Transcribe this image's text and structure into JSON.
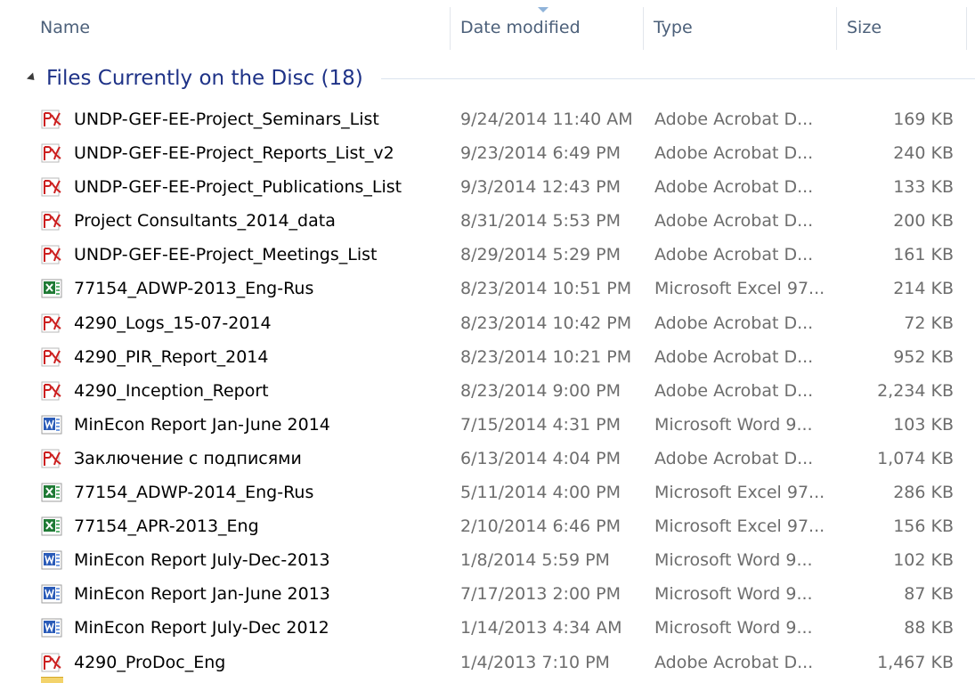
{
  "columns": {
    "name": "Name",
    "date_modified": "Date modified",
    "type": "Type",
    "size": "Size"
  },
  "group": {
    "title": "Files Currently on the Disc (18)"
  },
  "colors": {
    "group_title": "#1e3287",
    "header_text": "#4c607a",
    "secondary_text": "#6d6d6d",
    "pdf_icon": "#cc1f1f",
    "excel_icon": "#1f7a35",
    "word_icon": "#2a5bb8"
  },
  "files": [
    {
      "icon": "pdf-icon",
      "name": "UNDP-GEF-EE-Project_Seminars_List",
      "date": "9/24/2014 11:40 AM",
      "type": "Adobe Acrobat D...",
      "size": "169 KB"
    },
    {
      "icon": "pdf-icon",
      "name": "UNDP-GEF-EE-Project_Reports_List_v2",
      "date": "9/23/2014 6:49 PM",
      "type": "Adobe Acrobat D...",
      "size": "240 KB"
    },
    {
      "icon": "pdf-icon",
      "name": "UNDP-GEF-EE-Project_Publications_List",
      "date": "9/3/2014 12:43 PM",
      "type": "Adobe Acrobat D...",
      "size": "133 KB"
    },
    {
      "icon": "pdf-icon",
      "name": "Project Consultants_2014_data",
      "date": "8/31/2014 5:53 PM",
      "type": "Adobe Acrobat D...",
      "size": "200 KB"
    },
    {
      "icon": "pdf-icon",
      "name": "UNDP-GEF-EE-Project_Meetings_List",
      "date": "8/29/2014 5:29 PM",
      "type": "Adobe Acrobat D...",
      "size": "161 KB"
    },
    {
      "icon": "excel-icon",
      "name": "77154_ADWP-2013_Eng-Rus",
      "date": "8/23/2014 10:51 PM",
      "type": "Microsoft Excel 97...",
      "size": "214 KB"
    },
    {
      "icon": "pdf-icon",
      "name": "4290_Logs_15-07-2014",
      "date": "8/23/2014 10:42 PM",
      "type": "Adobe Acrobat D...",
      "size": "72 KB"
    },
    {
      "icon": "pdf-icon",
      "name": "4290_PIR_Report_2014",
      "date": "8/23/2014 10:21 PM",
      "type": "Adobe Acrobat D...",
      "size": "952 KB"
    },
    {
      "icon": "pdf-icon",
      "name": "4290_Inception_Report",
      "date": "8/23/2014 9:00 PM",
      "type": "Adobe Acrobat D...",
      "size": "2,234 KB"
    },
    {
      "icon": "word-icon",
      "name": "MinEcon Report Jan-June 2014",
      "date": "7/15/2014 4:31 PM",
      "type": "Microsoft Word 9...",
      "size": "103 KB"
    },
    {
      "icon": "pdf-icon",
      "name": "Заключение с подписями",
      "date": "6/13/2014 4:04 PM",
      "type": "Adobe Acrobat D...",
      "size": "1,074 KB"
    },
    {
      "icon": "excel-icon",
      "name": "77154_ADWP-2014_Eng-Rus",
      "date": "5/11/2014 4:00 PM",
      "type": "Microsoft Excel 97...",
      "size": "286 KB"
    },
    {
      "icon": "excel-icon",
      "name": "77154_APR-2013_Eng",
      "date": "2/10/2014 6:46 PM",
      "type": "Microsoft Excel 97...",
      "size": "156 KB"
    },
    {
      "icon": "word-icon",
      "name": "MinEcon Report July-Dec-2013",
      "date": "1/8/2014 5:59 PM",
      "type": "Microsoft Word 9...",
      "size": "102 KB"
    },
    {
      "icon": "word-icon",
      "name": "MinEcon Report Jan-June 2013",
      "date": "7/17/2013 2:00 PM",
      "type": "Microsoft Word 9...",
      "size": "87 KB"
    },
    {
      "icon": "word-icon",
      "name": "MinEcon Report July-Dec 2012",
      "date": "1/14/2013 4:34 AM",
      "type": "Microsoft Word 9...",
      "size": "88 KB"
    },
    {
      "icon": "pdf-icon",
      "name": "4290_ProDoc_Eng",
      "date": "1/4/2013 7:10 PM",
      "type": "Adobe Acrobat D...",
      "size": "1,467 KB"
    }
  ]
}
